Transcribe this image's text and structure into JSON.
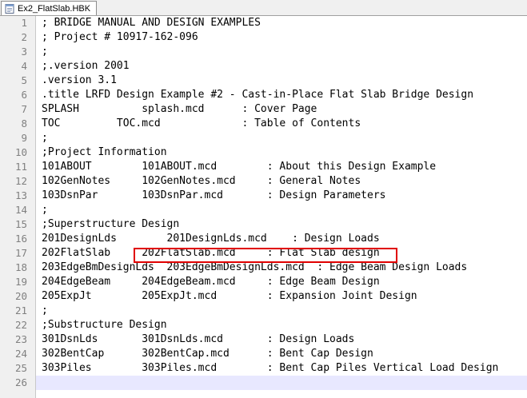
{
  "tab": {
    "title": "Ex2_FlatSlab.HBK",
    "icon": "notepad-file-icon"
  },
  "lines": [
    {
      "n": "1",
      "text": "; BRIDGE MANUAL AND DESIGN EXAMPLES"
    },
    {
      "n": "2",
      "text": "; Project # 10917-162-096"
    },
    {
      "n": "3",
      "text": ";"
    },
    {
      "n": "4",
      "text": ";.version 2001"
    },
    {
      "n": "5",
      "text": ".version 3.1"
    },
    {
      "n": "6",
      "text": ".title LRFD Design Example #2 - Cast-in-Place Flat Slab Bridge Design"
    },
    {
      "n": "7",
      "text": "SPLASH          splash.mcd      : Cover Page"
    },
    {
      "n": "8",
      "text": "TOC         TOC.mcd             : Table of Contents"
    },
    {
      "n": "9",
      "text": ";"
    },
    {
      "n": "10",
      "text": ";Project Information"
    },
    {
      "n": "11",
      "text": "101ABOUT        101ABOUT.mcd        : About this Design Example"
    },
    {
      "n": "12",
      "text": "102GenNotes     102GenNotes.mcd     : General Notes"
    },
    {
      "n": "13",
      "text": "103DsnPar       103DsnPar.mcd       : Design Parameters"
    },
    {
      "n": "14",
      "text": ";"
    },
    {
      "n": "15",
      "text": ";Superstructure Design"
    },
    {
      "n": "16",
      "text": "201DesignLds        201DesignLds.mcd    : Design Loads"
    },
    {
      "n": "17",
      "text": "202FlatSlab     202FlatSlab.mcd     : Flat Slab design"
    },
    {
      "n": "18",
      "text": "203EdgeBmDesignLds  203EdgeBmDesignLds.mcd  : Edge Beam Design Loads"
    },
    {
      "n": "19",
      "text": "204EdgeBeam     204EdgeBeam.mcd     : Edge Beam Design"
    },
    {
      "n": "20",
      "text": "205ExpJt        205ExpJt.mcd        : Expansion Joint Design"
    },
    {
      "n": "21",
      "text": ";"
    },
    {
      "n": "22",
      "text": ";Substructure Design"
    },
    {
      "n": "23",
      "text": "301DsnLds       301DsnLds.mcd       : Design Loads"
    },
    {
      "n": "24",
      "text": "302BentCap      302BentCap.mcd      : Bent Cap Design"
    },
    {
      "n": "25",
      "text": "303Piles        303Piles.mcd        : Bent Cap Piles Vertical Load Design"
    },
    {
      "n": "26",
      "text": ""
    }
  ],
  "current_line": "26",
  "highlighted_line": "17",
  "colors": {
    "highlight_box": "#e00000",
    "current_line_bg": "#e8e8ff",
    "line_number": "#808080"
  }
}
